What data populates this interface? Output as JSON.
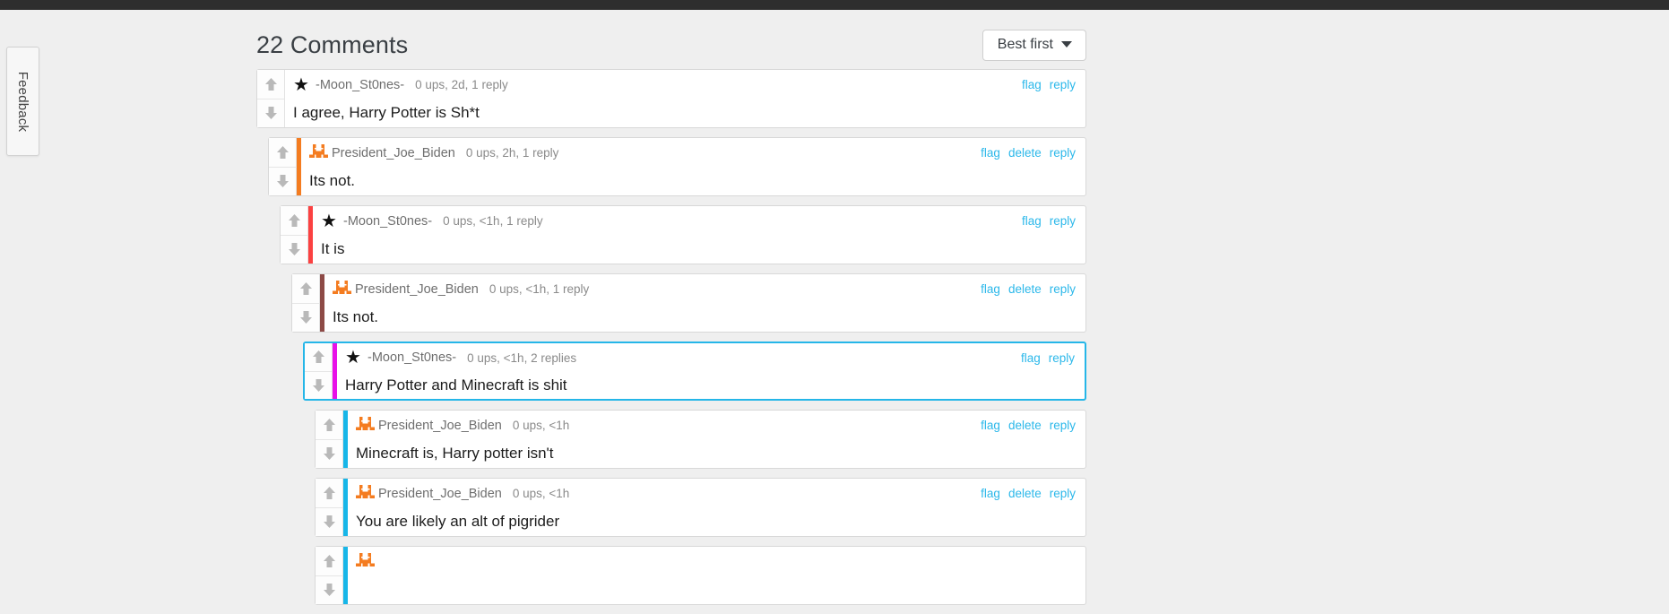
{
  "page": {
    "background_color": "#efefef",
    "topbar_color": "#2e2e2e"
  },
  "feedback_tab": {
    "label": "Feedback"
  },
  "header": {
    "title": "22 Comments",
    "sort_button": {
      "label": "Best first",
      "icon": "chevron-down-icon"
    }
  },
  "colors": {
    "link": "#2cb8ea",
    "highlight_border": "#25b6e8",
    "stripe_orange": "#f47c20",
    "stripe_red": "#fb4141",
    "stripe_maroon": "#8d4a46",
    "stripe_magenta": "#e810e8",
    "stripe_cyan": "#17b6e8"
  },
  "comments": [
    {
      "indent": 0,
      "avatar": "star-icon",
      "avatar_glyph": "★",
      "stripe": "none",
      "username": "-Moon_St0nes-",
      "stats": "0 ups, 2d, 1 reply",
      "text": "I agree, Harry Potter is Sh*t",
      "actions": [
        "flag",
        "reply"
      ],
      "highlight": false
    },
    {
      "indent": 1,
      "avatar": "bunny-sprite-icon",
      "avatar_glyph": "",
      "stripe": "#f47c20",
      "username": "President_Joe_Biden",
      "stats": "0 ups, 2h, 1 reply",
      "text": "Its not.",
      "actions": [
        "flag",
        "delete",
        "reply"
      ],
      "highlight": false
    },
    {
      "indent": 2,
      "avatar": "star-icon",
      "avatar_glyph": "★",
      "stripe": "#fb4141",
      "username": "-Moon_St0nes-",
      "stats": "0 ups, <1h, 1 reply",
      "text": "It is",
      "actions": [
        "flag",
        "reply"
      ],
      "highlight": false
    },
    {
      "indent": 3,
      "avatar": "bunny-sprite-icon",
      "avatar_glyph": "",
      "stripe": "#8d4a46",
      "username": "President_Joe_Biden",
      "stats": "0 ups, <1h, 1 reply",
      "text": "Its not.",
      "actions": [
        "flag",
        "delete",
        "reply"
      ],
      "highlight": false
    },
    {
      "indent": 4,
      "avatar": "star-icon",
      "avatar_glyph": "★",
      "stripe": "#e810e8",
      "username": "-Moon_St0nes-",
      "stats": "0 ups, <1h, 2 replies",
      "text": "Harry Potter and Minecraft is shit",
      "actions": [
        "flag",
        "reply"
      ],
      "highlight": true
    },
    {
      "indent": 5,
      "avatar": "bunny-sprite-icon",
      "avatar_glyph": "",
      "stripe": "#17b6e8",
      "username": "President_Joe_Biden",
      "stats": "0 ups, <1h",
      "text": "Minecraft is, Harry potter isn't",
      "actions": [
        "flag",
        "delete",
        "reply"
      ],
      "highlight": false
    },
    {
      "indent": 5,
      "avatar": "bunny-sprite-icon",
      "avatar_glyph": "",
      "stripe": "#17b6e8",
      "username": "President_Joe_Biden",
      "stats": "0 ups, <1h",
      "text": "You are likely an alt of pigrider",
      "actions": [
        "flag",
        "delete",
        "reply"
      ],
      "highlight": false
    },
    {
      "indent": 5,
      "avatar": "bunny-sprite-icon",
      "avatar_glyph": "",
      "stripe": "#17b6e8",
      "username": "",
      "stats": "",
      "text": "",
      "actions": [],
      "highlight": false,
      "partial": true
    }
  ]
}
